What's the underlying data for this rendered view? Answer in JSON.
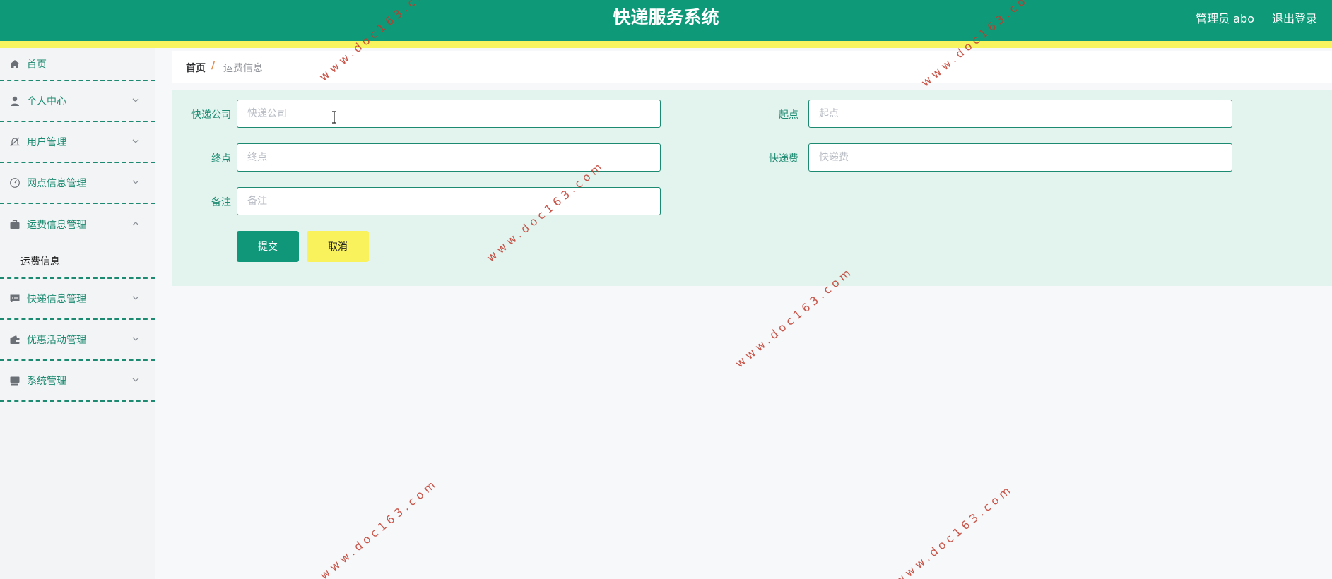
{
  "header": {
    "title": "快递服务系统",
    "user": "管理员 abo",
    "logout": "退出登录"
  },
  "sidebar": {
    "items": [
      {
        "label": "首页",
        "icon": "home-icon"
      },
      {
        "label": "个人中心",
        "icon": "user-icon"
      },
      {
        "label": "用户管理",
        "icon": "bell-off-icon"
      },
      {
        "label": "网点信息管理",
        "icon": "gauge-icon"
      },
      {
        "label": "运费信息管理",
        "icon": "briefcase-icon",
        "expanded": true,
        "children": [
          {
            "label": "运费信息"
          }
        ]
      },
      {
        "label": "快递信息管理",
        "icon": "chat-icon"
      },
      {
        "label": "优惠活动管理",
        "icon": "wallet-icon"
      },
      {
        "label": "系统管理",
        "icon": "monitor-icon"
      }
    ]
  },
  "breadcrumb": {
    "home": "首页",
    "separator": "/",
    "current": "运费信息"
  },
  "form": {
    "company": {
      "label": "快递公司",
      "placeholder": "快递公司",
      "value": ""
    },
    "origin": {
      "label": "起点",
      "placeholder": "起点",
      "value": ""
    },
    "destination": {
      "label": "终点",
      "placeholder": "终点",
      "value": ""
    },
    "fee": {
      "label": "快递费",
      "placeholder": "快递费",
      "value": ""
    },
    "remark": {
      "label": "备注",
      "placeholder": "备注",
      "value": ""
    },
    "submit": "提交",
    "cancel": "取消"
  },
  "watermark": "www.doc163.com",
  "colors": {
    "primary": "#0e9a78",
    "accent_yellow": "#f7f45f",
    "panel_bg": "#e3f4ef",
    "watermark": "#c0392b"
  }
}
